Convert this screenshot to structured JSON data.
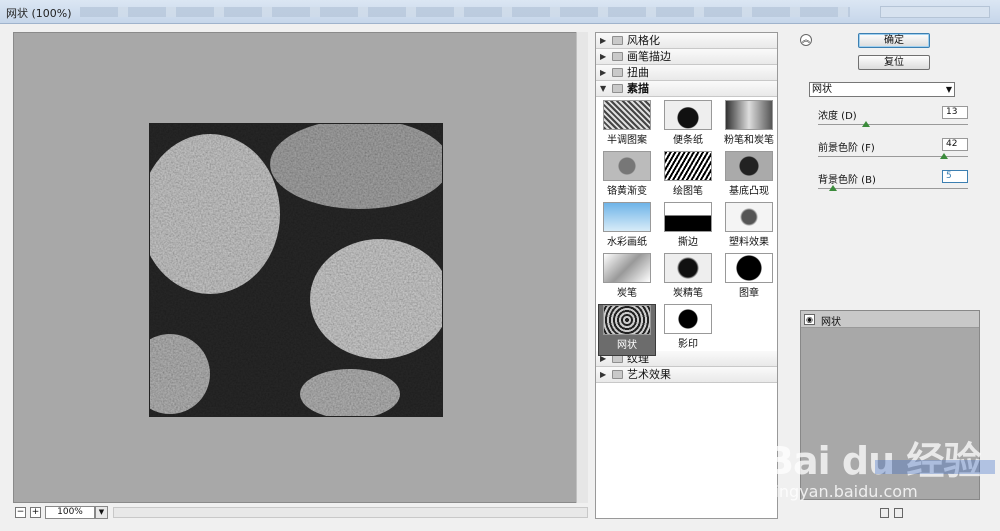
{
  "window": {
    "title": "网状 (100%)"
  },
  "preview": {
    "zoom": "100%",
    "zoom_out": "−",
    "zoom_in": "+"
  },
  "browser": {
    "categories_top": [
      {
        "label": "风格化"
      },
      {
        "label": "画笔描边"
      },
      {
        "label": "扭曲"
      }
    ],
    "open_category": {
      "label": "素描"
    },
    "filters": [
      {
        "name": "半调图案"
      },
      {
        "name": "便条纸"
      },
      {
        "name": "粉笔和炭笔"
      },
      {
        "name": "铬黄渐变"
      },
      {
        "name": "绘图笔"
      },
      {
        "name": "基底凸现"
      },
      {
        "name": "水彩画纸"
      },
      {
        "name": "撕边"
      },
      {
        "name": "塑料效果"
      },
      {
        "name": "炭笔"
      },
      {
        "name": "炭精笔"
      },
      {
        "name": "图章"
      },
      {
        "name": "网状"
      },
      {
        "name": "影印"
      }
    ],
    "selected_filter": "网状",
    "categories_bottom": [
      {
        "label": "纹理"
      },
      {
        "label": "艺术效果"
      }
    ]
  },
  "buttons": {
    "ok": "确定",
    "reset": "复位",
    "collapse": "︽"
  },
  "settings": {
    "filter_select": "网状",
    "params": [
      {
        "label": "浓度 (D)",
        "value": "13",
        "level": 0.32
      },
      {
        "label": "前景色阶 (F)",
        "value": "42",
        "level": 0.84
      },
      {
        "label": "背景色阶 (B)",
        "value": "5",
        "level": 0.1
      }
    ]
  },
  "layers": {
    "item": "网状"
  },
  "watermark": {
    "logo": "Bai du 经验",
    "url": "jingyan.baidu.com"
  },
  "colors": {
    "preview_bg": "#a8a8a8",
    "knob": "#3a8a3a",
    "accent": "#3c7fb1"
  }
}
